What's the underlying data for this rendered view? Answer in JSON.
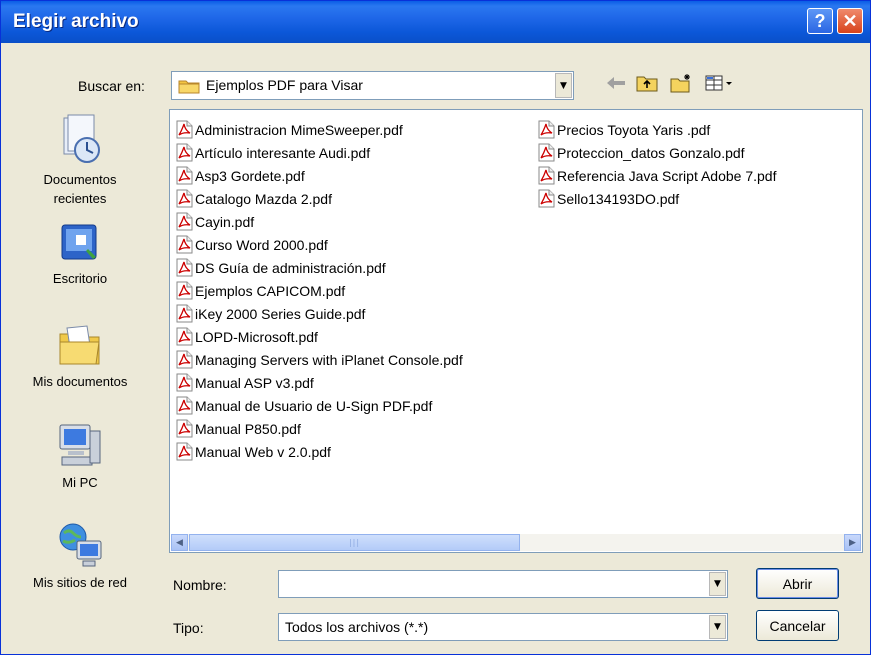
{
  "window": {
    "title": "Elegir archivo",
    "help_label": "?",
    "close_label": "✕"
  },
  "lookin": {
    "label": "Buscar en:",
    "value": "Ejemplos PDF para Visar"
  },
  "toolbar": {
    "icons": [
      "back-arrow-icon",
      "up-folder-icon",
      "new-folder-icon",
      "view-menu-icon"
    ]
  },
  "places": [
    {
      "name": "Documentos recientes",
      "line1": "Documentos",
      "line2": "recientes",
      "icon": "recent-documents-icon"
    },
    {
      "name": "Escritorio",
      "line1": "Escritorio",
      "line2": "",
      "icon": "desktop-icon"
    },
    {
      "name": "Mis documentos",
      "line1": "Mis documentos",
      "line2": "",
      "icon": "my-documents-icon"
    },
    {
      "name": "Mi PC",
      "line1": "Mi PC",
      "line2": "",
      "icon": "my-computer-icon"
    },
    {
      "name": "Mis sitios de red",
      "line1": "Mis sitios de red",
      "line2": "",
      "icon": "network-places-icon"
    }
  ],
  "files": {
    "column1": [
      "Administracion MimeSweeper.pdf",
      "Artículo interesante Audi.pdf",
      "Asp3 Gordete.pdf",
      "Catalogo Mazda 2.pdf",
      "Cayin.pdf",
      "Curso Word 2000.pdf",
      "DS Guía de administración.pdf",
      "Ejemplos CAPICOM.pdf",
      "iKey 2000 Series Guide.pdf",
      "LOPD-Microsoft.pdf",
      "Managing Servers with iPlanet Console.pdf",
      "Manual ASP v3.pdf",
      "Manual de Usuario de U-Sign PDF.pdf",
      "Manual P850.pdf",
      "Manual Web v 2.0.pdf"
    ],
    "column2": [
      "Precios Toyota Yaris .pdf",
      "Proteccion_datos Gonzalo.pdf",
      "Referencia Java Script Adobe 7.pdf",
      "Sello134193DO.pdf"
    ]
  },
  "filename": {
    "label": "Nombre:",
    "value": ""
  },
  "filetype": {
    "label": "Tipo:",
    "value": "Todos los archivos (*.*)"
  },
  "buttons": {
    "open": "Abrir",
    "cancel": "Cancelar"
  },
  "colors": {
    "titlebar": "#0a5de6",
    "close": "#d7431b",
    "face": "#ece9d8",
    "pdf_red": "#cc0000"
  }
}
